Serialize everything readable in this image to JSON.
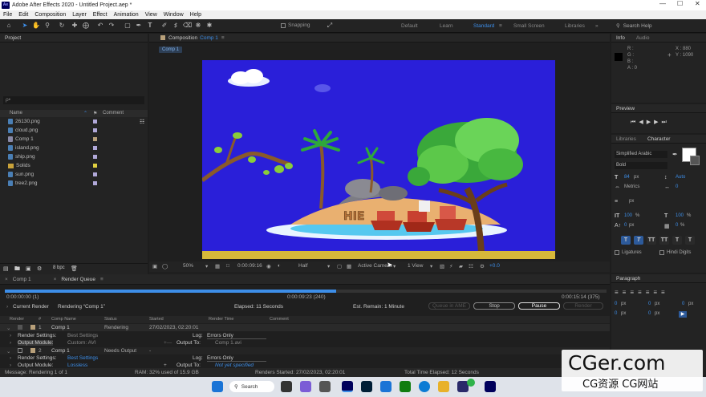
{
  "title_bar": {
    "title": "Adobe After Effects 2020 - Untitled Project.aep *",
    "app_badge": "Ae"
  },
  "menu": [
    "File",
    "Edit",
    "Composition",
    "Layer",
    "Effect",
    "Animation",
    "View",
    "Window",
    "Help"
  ],
  "toolbar": {
    "snapping": "Snapping",
    "workspaces": [
      "Default",
      "Learn",
      "Standard",
      "Small Screen",
      "Libraries"
    ],
    "active_workspace": "Standard",
    "search_placeholder": "Search Help"
  },
  "project": {
    "tab": "Project",
    "search_placeholder": "ρ•",
    "col_name": "Name",
    "col_comment": "Comment",
    "bpc": "8 bpc",
    "items": [
      {
        "name": "26130.png",
        "kind": "file",
        "color": "#b0a8d8"
      },
      {
        "name": "cloud.png",
        "kind": "file",
        "color": "#b0a8d8"
      },
      {
        "name": "Comp 1",
        "kind": "comp",
        "color": "#b8a07a"
      },
      {
        "name": "island.png",
        "kind": "file",
        "color": "#b0a8d8"
      },
      {
        "name": "ship.png",
        "kind": "file",
        "color": "#b0a8d8"
      },
      {
        "name": "Solids",
        "kind": "folder",
        "color": "#e0d040"
      },
      {
        "name": "sun.png",
        "kind": "file",
        "color": "#b0a8d8"
      },
      {
        "name": "tree2.png",
        "kind": "file",
        "color": "#b0a8d8"
      }
    ]
  },
  "composition": {
    "tab_prefix": "Composition",
    "tab_name": "Comp 1",
    "breadcrumb": "Comp 1",
    "island_text": "HIE"
  },
  "viewer": {
    "zoom": "50%",
    "timecode": "0:00:09:16",
    "resolution": "Half",
    "camera": "Active Camera",
    "views": "1 View",
    "exposure": "+0.0"
  },
  "info": {
    "tab_info": "Info",
    "tab_audio": "Audio",
    "r": "R :",
    "g": "G :",
    "b": "B :",
    "a": "A : 0",
    "x": "X : 880",
    "y": "Y : 1090"
  },
  "preview": {
    "tab": "Preview"
  },
  "libraries": {
    "tab": "Libraries",
    "character_tab": "Character",
    "font": "Simplified Arabic",
    "style": "Bold",
    "size": "84",
    "size_unit": "px",
    "leading": "Auto",
    "kerning_label": "Metrics",
    "tracking": "0",
    "stroke_unit": "px",
    "vscale": "100",
    "hscale": "100",
    "scale_unit": "%",
    "baseline": "0",
    "tsume": "0",
    "baseline_unit": "px",
    "tsume_unit": "%",
    "ligatures": "Ligatures",
    "hindi_digits": "Hindi Digits"
  },
  "paragraph": {
    "tab": "Paragraph",
    "v1": "0",
    "v2": "0",
    "v3": "0",
    "v4": "0",
    "v5": "0",
    "unit": "px"
  },
  "render_queue": {
    "tab_comp": "Comp 1",
    "tab_rq": "Render Queue",
    "time_start": "0:00:00:00 (1)",
    "time_mid": "0:00:09:23 (240)",
    "time_end": "0:00:15:14 (375)",
    "progress": 0.55,
    "current_render": "Current Render",
    "rendering_label": "Rendering “Comp 1”",
    "elapsed": "Elapsed: 11 Seconds",
    "remaining": "Est. Remain: 1 Minute",
    "queue_ame": "Queue in AME",
    "stop": "Stop",
    "pause": "Pause",
    "render_btn": "Render",
    "headers": [
      "Render",
      "#",
      "Comp Name",
      "Status",
      "Started",
      "Render Time",
      "Comment"
    ],
    "row1": {
      "num": "1",
      "comp": "Comp 1",
      "status": "Rendering",
      "started": "27/02/2023, 02:20:01",
      "rs_label": "Render Settings:",
      "rs": "Best Settings",
      "om_label": "Output Module:",
      "om": "Custom: AVI",
      "log_label": "Log:",
      "log": "Errors Only",
      "out_label": "Output To:",
      "out": "Comp 1.avi"
    },
    "row2": {
      "num": "2",
      "comp": "Comp 1",
      "status": "Needs Output",
      "started": "-",
      "rs_label": "Render Settings:",
      "rs": "Best Settings",
      "om_label": "Output Module:",
      "om": "Lossless",
      "log_label": "Log:",
      "log": "Errors Only",
      "out_label": "Output To:",
      "out": "Not yet specified"
    },
    "status_bar": {
      "message": "Message: Rendering 1 of 1",
      "ram": "RAM: 32% used of 15.9 GB",
      "started": "Renders Started: 27/02/2023, 02:20:01",
      "total": "Total Time Elapsed: 12 Seconds"
    }
  },
  "taskbar": {
    "search": "Search"
  },
  "watermark": {
    "line1": "CGer.com",
    "line2": "CG资源 CG网站"
  }
}
